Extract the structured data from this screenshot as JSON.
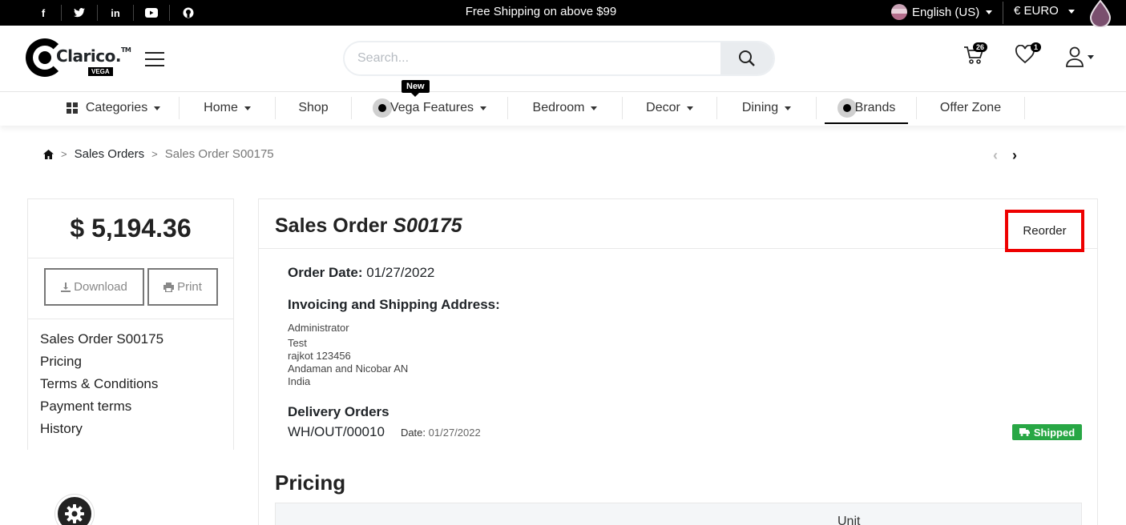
{
  "topbar": {
    "social": [
      "facebook-icon",
      "twitter-icon",
      "linkedin-icon",
      "youtube-icon",
      "github-icon"
    ],
    "promo": "Free Shipping on above $99",
    "language": "English (US)",
    "currency": "€ EURO"
  },
  "header": {
    "logo_text": "Clarico.",
    "logo_tm": "TM",
    "logo_sub": "VEGA",
    "search_placeholder": "Search...",
    "cart_count": "26",
    "wishlist_count": "1"
  },
  "nav": {
    "new_tag": "New",
    "items": [
      "Categories",
      "Home",
      "Shop",
      "Vega Features",
      "Bedroom",
      "Decor",
      "Dining",
      "Brands",
      "Offer Zone"
    ]
  },
  "breadcrumb": {
    "sales_orders": "Sales Orders",
    "current": "Sales Order S00175"
  },
  "sidebar": {
    "amount": "$ 5,194.36",
    "download": "Download",
    "print": "Print",
    "links": [
      "Sales Order S00175",
      "Pricing",
      "Terms & Conditions",
      "Payment terms",
      "History"
    ]
  },
  "order": {
    "title_prefix": "Sales Order",
    "title_number": "S00175",
    "reorder": "Reorder",
    "date_label": "Order Date:",
    "date_value": "01/27/2022",
    "address_heading": "Invoicing and Shipping Address:",
    "address_lines": [
      "Administrator",
      "Test",
      "rajkot 123456",
      "Andaman and Nicobar AN",
      "India"
    ],
    "delivery_heading": "Delivery Orders",
    "delivery_ref": "WH/OUT/00010",
    "delivery_date_label": "Date:",
    "delivery_date": "01/27/2022",
    "status": "Shipped",
    "status_color": "#28a745",
    "pricing_heading": "Pricing",
    "pricing_col": "Unit"
  },
  "colors": {
    "highlight": "#e00000",
    "topbar_bg": "#000000"
  }
}
